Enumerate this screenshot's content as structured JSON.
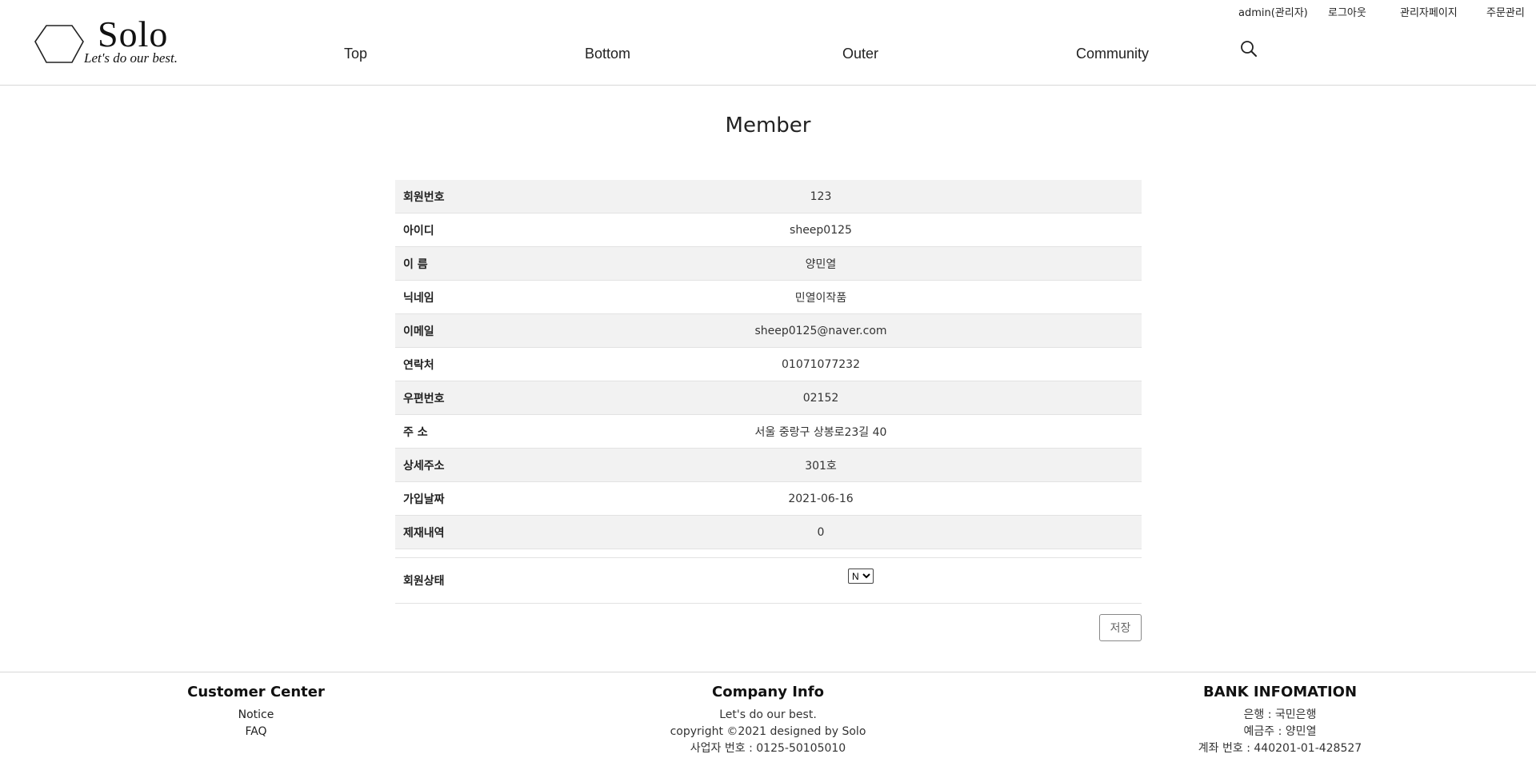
{
  "header": {
    "logo_title": "Solo",
    "logo_slogan": "Let's do our best.",
    "nav": [
      "Top",
      "Bottom",
      "Outer",
      "Community"
    ],
    "util": {
      "user": "admin(관리자)",
      "logout": "로그아웃",
      "admin_page": "관리자페이지",
      "order_manage": "주문관리"
    }
  },
  "main": {
    "title": "Member",
    "rows": [
      {
        "label": "회원번호",
        "value": "123"
      },
      {
        "label": "아이디",
        "value": "sheep0125"
      },
      {
        "label": "이 름",
        "value": "양민열"
      },
      {
        "label": "닉네임",
        "value": "민열이작품"
      },
      {
        "label": "이메일",
        "value": "sheep0125@naver.com"
      },
      {
        "label": "연락처",
        "value": "01071077232"
      },
      {
        "label": "우편번호",
        "value": "02152"
      },
      {
        "label": "주 소",
        "value": "서울 중랑구 상봉로23길 40"
      },
      {
        "label": "상세주소",
        "value": "301호"
      },
      {
        "label": "가입날짜",
        "value": "2021-06-16"
      },
      {
        "label": "제재내역",
        "value": "0"
      }
    ],
    "status_label": "회원상태",
    "status_value": "N",
    "save_label": "저장"
  },
  "footer": {
    "customer": {
      "title": "Customer Center",
      "notice": "Notice",
      "faq": "FAQ"
    },
    "company": {
      "title": "Company Info",
      "lines": [
        "Let's do our best.",
        "copyright ©2021 designed by Solo",
        "사업자 번호 : 0125-50105010"
      ]
    },
    "bank": {
      "title": "BANK INFOMATION",
      "lines": [
        "은행 : 국민은행",
        "예금주 : 양민열",
        "계좌 번호 : 440201-01-428527"
      ]
    }
  }
}
